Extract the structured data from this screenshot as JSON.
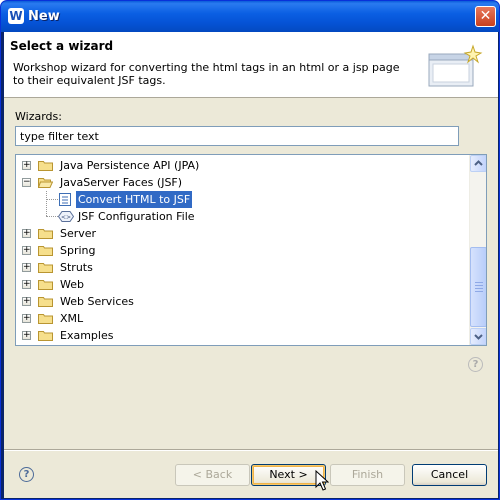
{
  "window": {
    "title": "New",
    "close": "✕"
  },
  "header": {
    "title": "Select a wizard",
    "description": "Workshop wizard for converting the html tags in an html or a jsp page to their equivalent JSF tags."
  },
  "wizards_label": "Wizards:",
  "filter": {
    "value": "type filter text"
  },
  "tree": {
    "items": [
      {
        "label": "Java Persistence API (JPA)",
        "expander": "+"
      },
      {
        "label": "JavaServer Faces (JSF)",
        "expander": "−"
      },
      {
        "label": "Convert HTML to JSF"
      },
      {
        "label": "JSF Configuration File"
      },
      {
        "label": "Server",
        "expander": "+"
      },
      {
        "label": "Spring",
        "expander": "+"
      },
      {
        "label": "Struts",
        "expander": "+"
      },
      {
        "label": "Web",
        "expander": "+"
      },
      {
        "label": "Web Services",
        "expander": "+"
      },
      {
        "label": "XML",
        "expander": "+"
      },
      {
        "label": "Examples",
        "expander": "+"
      }
    ]
  },
  "help": {
    "symbol": "?"
  },
  "buttons": {
    "back": "< Back",
    "next": "Next >",
    "finish": "Finish",
    "cancel": "Cancel"
  },
  "colors": {
    "selection": "#316ac5",
    "titlebar": "#0553d6",
    "dialog": "#ece9d8"
  }
}
